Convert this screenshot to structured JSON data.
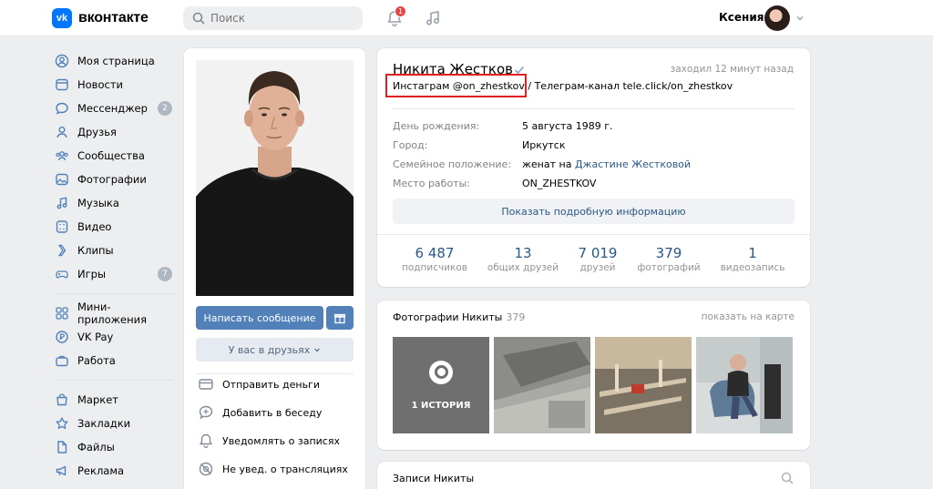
{
  "header": {
    "logo_mark": "vk",
    "logo_text": "вконтакте",
    "search_placeholder": "Поиск",
    "notifications_count": "1",
    "user_name": "Ксения"
  },
  "sidebar": {
    "items": [
      {
        "label": "Моя страница",
        "icon": "user-circle-icon"
      },
      {
        "label": "Новости",
        "icon": "newspaper-icon"
      },
      {
        "label": "Мессенджер",
        "icon": "chat-bubble-icon",
        "count": "2"
      },
      {
        "label": "Друзья",
        "icon": "person-icon"
      },
      {
        "label": "Сообщества",
        "icon": "group-icon"
      },
      {
        "label": "Фотографии",
        "icon": "photo-icon"
      },
      {
        "label": "Музыка",
        "icon": "music-note-icon"
      },
      {
        "label": "Видео",
        "icon": "video-icon"
      },
      {
        "label": "Клипы",
        "icon": "clips-icon"
      },
      {
        "label": "Игры",
        "icon": "gamepad-icon",
        "count": "7"
      }
    ],
    "items2": [
      {
        "label": "Мини-приложения",
        "icon": "grid-icon"
      },
      {
        "label": "VK Pay",
        "icon": "coin-icon"
      },
      {
        "label": "Работа",
        "icon": "briefcase-icon"
      }
    ],
    "items3": [
      {
        "label": "Маркет",
        "icon": "bag-icon"
      },
      {
        "label": "Закладки",
        "icon": "star-icon"
      },
      {
        "label": "Файлы",
        "icon": "file-icon"
      },
      {
        "label": "Реклама",
        "icon": "megaphone-icon"
      }
    ]
  },
  "left_card": {
    "message_button": "Написать сообщение",
    "friends_button": "У вас в друзьях",
    "actions": [
      {
        "label": "Отправить деньги",
        "icon": "money-transfer-icon"
      },
      {
        "label": "Добавить в беседу",
        "icon": "add-chat-icon"
      },
      {
        "label": "Уведомлять о записях",
        "icon": "bell-icon"
      },
      {
        "label": "Не увед. о трансляциях",
        "icon": "broadcast-off-icon"
      }
    ]
  },
  "profile": {
    "name": "Никита Жестков",
    "last_seen": "заходил 12 минут назад",
    "status_instagram": "Инстаграм @on_zhestkov /",
    "status_telegram": " Телеграм-канал tele.click/on_zhestkov",
    "rows": [
      {
        "key": "День рождения:",
        "value": "5 августа 1989 г.",
        "link": true
      },
      {
        "key": "Город:",
        "value": "Иркутск",
        "link": true
      },
      {
        "key": "Семейное положение:",
        "value_prefix": "женат на ",
        "value": "Джастине Жестковой",
        "link": true
      },
      {
        "key": "Место работы:",
        "value": "ON_ZHESTKOV",
        "link": true
      }
    ],
    "details_button": "Показать подробную информацию",
    "counters": [
      {
        "number": "6 487",
        "label": "подписчиков"
      },
      {
        "number": "13",
        "label": "общих друзей"
      },
      {
        "number": "7 019",
        "label": "друзей"
      },
      {
        "number": "379",
        "label": "фотографий"
      },
      {
        "number": "1",
        "label": "видеозапись"
      }
    ]
  },
  "photos": {
    "title": "Фотографии Никиты",
    "count": "379",
    "map_link": "показать на карте",
    "story_label": "1 ИСТОРИЯ"
  },
  "posts": {
    "title": "Записи Никиты"
  }
}
